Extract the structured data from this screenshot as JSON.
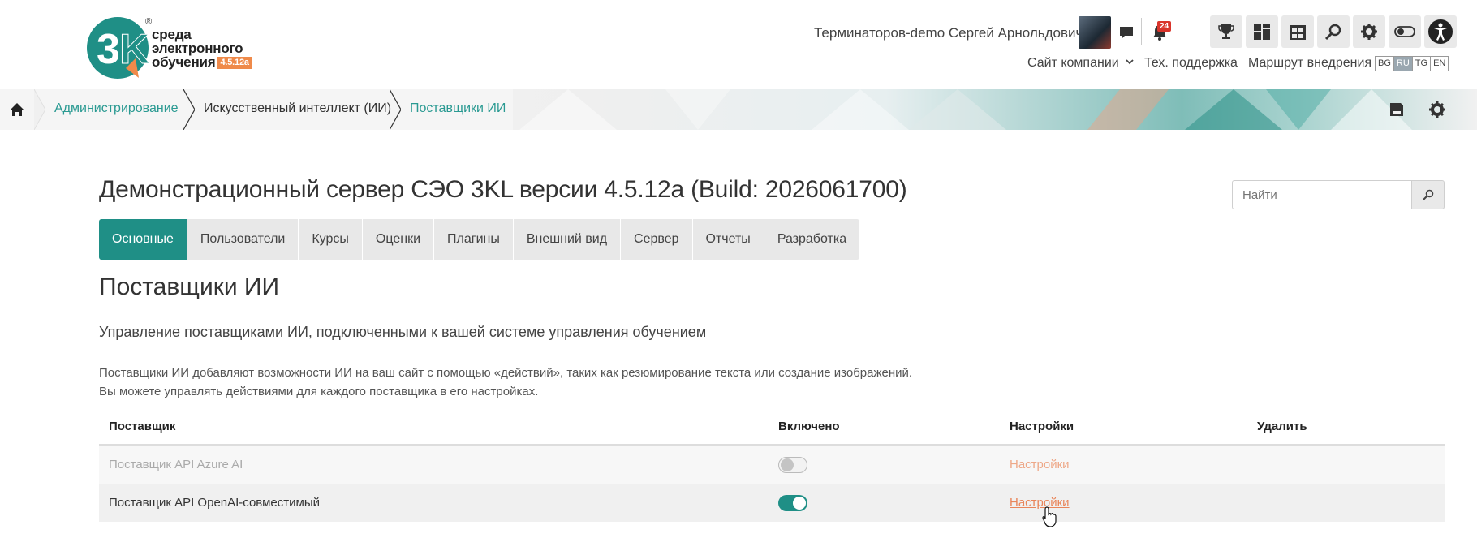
{
  "logo": {
    "line1": "среда",
    "line2": "электронного",
    "line3": "обучения",
    "version": "4.5.12a",
    "mark": "3K"
  },
  "header": {
    "user_name": "Терминаторов-demo Сергей Арнольдович",
    "notification_count": "24",
    "links": {
      "company_site": "Сайт компании",
      "support": "Тех. поддержка",
      "roadmap": "Маршрут внедрения"
    },
    "languages": [
      "BG",
      "RU",
      "TG",
      "EN"
    ],
    "active_language": "RU",
    "icons": [
      "message-icon",
      "bell-icon",
      "trophy-icon",
      "dashboard-icon",
      "calendar-icon",
      "search-icon",
      "gear-icon",
      "toggle-icon",
      "accessibility-icon"
    ]
  },
  "breadcrumb": {
    "items": [
      "Администрирование",
      "Искусственный интеллект (ИИ)",
      "Поставщики ИИ"
    ]
  },
  "page": {
    "title": "Демонстрационный сервер СЭО 3KL версии 4.5.12a (Build: 2026061700)",
    "search_placeholder": "Найти",
    "tabs": [
      "Основные",
      "Пользователи",
      "Курсы",
      "Оценки",
      "Плагины",
      "Внешний вид",
      "Сервер",
      "Отчеты",
      "Разработка"
    ],
    "active_tab": "Основные",
    "section_title": "Поставщики ИИ",
    "subtitle": "Управление поставщиками ИИ, подключенными к вашей системе управления обучением",
    "desc_line1": "Поставщики ИИ добавляют возможности ИИ на ваш сайт с помощью «действий», таких как резюмирование текста или создание изображений.",
    "desc_line2": "Вы можете управлять действиями для каждого поставщика в его настройках."
  },
  "table": {
    "headers": {
      "provider": "Поставщик",
      "enabled": "Включено",
      "settings": "Настройки",
      "delete": "Удалить"
    },
    "rows": [
      {
        "provider": "Поставщик API Azure AI",
        "enabled": false,
        "settings": "Настройки"
      },
      {
        "provider": "Поставщик API OpenAI-совместимый",
        "enabled": true,
        "settings": "Настройки"
      }
    ]
  },
  "colors": {
    "accent": "#1f8f86",
    "link": "#e9855a",
    "breadcrumb_link": "#2a9a92",
    "badge": "#d9342b",
    "version_badge": "#ef8a4a"
  }
}
